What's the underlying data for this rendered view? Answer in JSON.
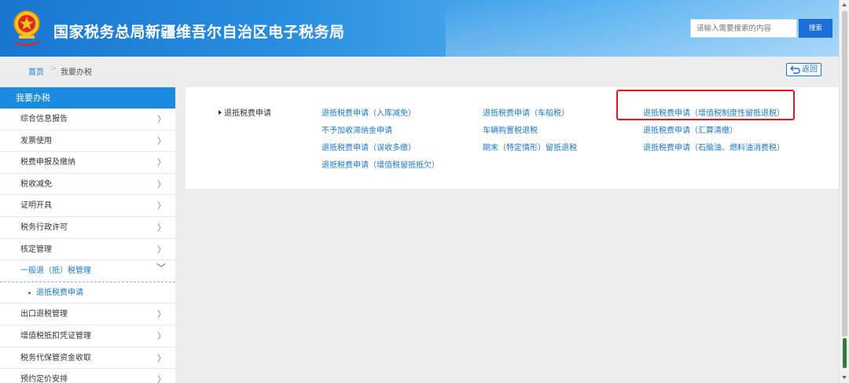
{
  "header": {
    "title": "国家税务总局新疆维吾尔自治区电子税务局",
    "search_placeholder": "请输入需要搜索的内容",
    "search_button": "搜索"
  },
  "breadcrumb": {
    "home": "首页",
    "separator": ">",
    "current": "我要办税",
    "back_label": "返回"
  },
  "sidebar": {
    "heading": "我要办税",
    "items": [
      {
        "label": "综合信息报告",
        "chevron": "〉"
      },
      {
        "label": "发票使用",
        "chevron": "〉"
      },
      {
        "label": "税费申报及缴纳",
        "chevron": "〉"
      },
      {
        "label": "税收减免",
        "chevron": "〉"
      },
      {
        "label": "证明开具",
        "chevron": "〉"
      },
      {
        "label": "税务行政许可",
        "chevron": "〉"
      },
      {
        "label": "核定管理",
        "chevron": "〉"
      },
      {
        "label": "一般退（抵）税管理",
        "chevron": "﹀"
      },
      {
        "label": "出口退税管理",
        "chevron": "〉"
      },
      {
        "label": "增值税抵扣凭证管理",
        "chevron": "〉"
      },
      {
        "label": "税务代保管资金收取",
        "chevron": "〉"
      },
      {
        "label": "预约定价安排",
        "chevron": "〉"
      }
    ],
    "sub_item": "退抵税费申请"
  },
  "main": {
    "category": "退抵税费申请",
    "links": [
      "退抵税费申请（入库减免）",
      "退抵税费申请（车船税）",
      "退抵税费申请（增值税制度性留抵退税）",
      "不予加收滞纳金申请",
      "车辆购置税退税",
      "退抵税费申请（汇算清缴）",
      "退抵税费申请（误收多缴）",
      "期末（特定情形）留抵退税",
      "退抵税费申请（石脑油、燃料油消费税）",
      "退抵税费申请（增值税留抵抵欠）"
    ]
  },
  "colors": {
    "accent": "#1a78d6",
    "header_start": "#1976cf",
    "highlight": "#e8141c"
  }
}
